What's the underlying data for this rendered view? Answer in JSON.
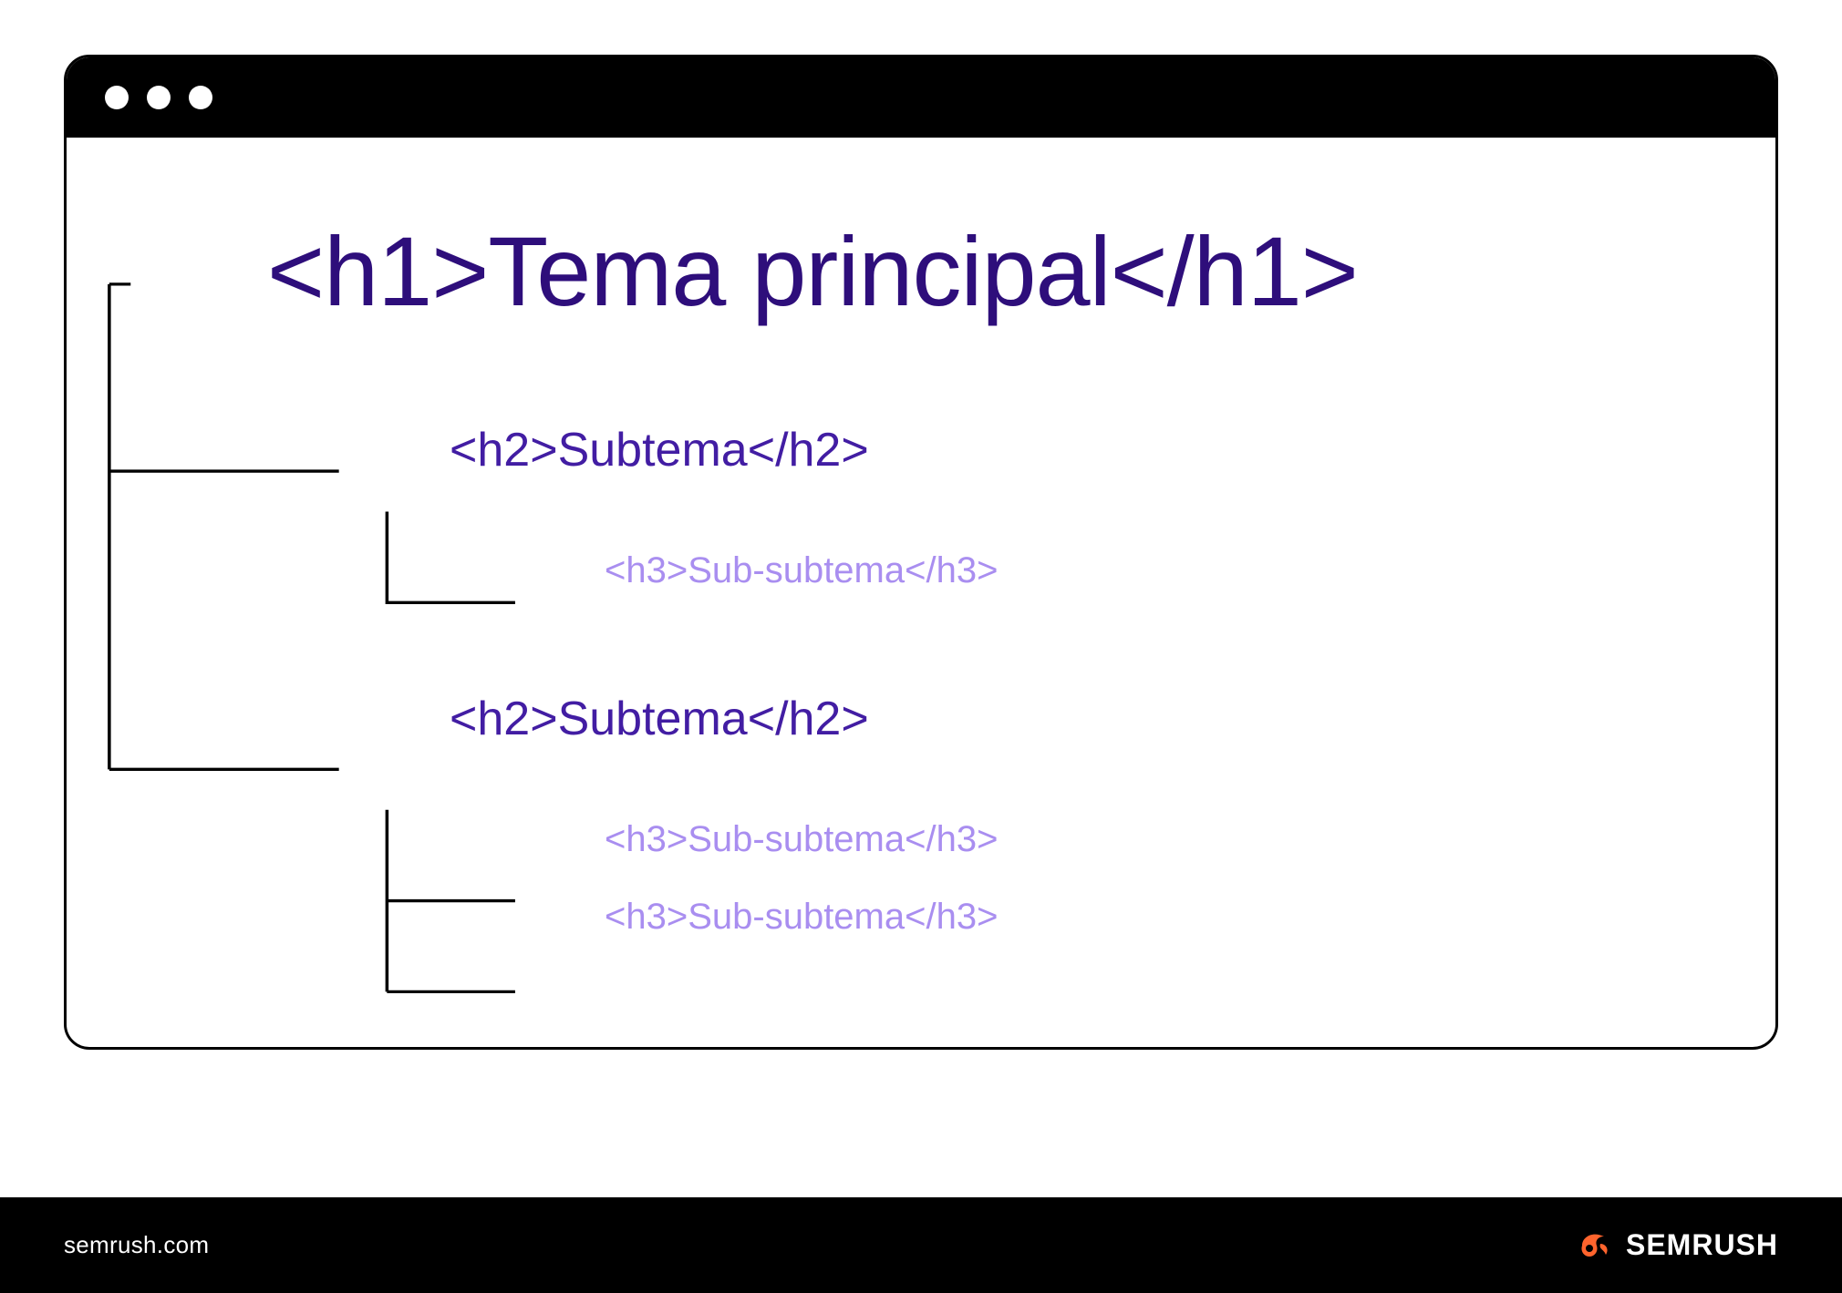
{
  "diagram": {
    "h1": "<h1>Tema principal</h1>",
    "groups": [
      {
        "h2": "<h2>Subtema</h2>",
        "h3": [
          "<h3>Sub-subtema</h3>"
        ]
      },
      {
        "h2": "<h2>Subtema</h2>",
        "h3": [
          "<h3>Sub-subtema</h3>",
          "<h3>Sub-subtema</h3>"
        ]
      }
    ]
  },
  "colors": {
    "h1": "#2E0E7B",
    "h2": "#421DA3",
    "h3": "#A98EF0",
    "brand_accent": "#FF642D"
  },
  "footer": {
    "url": "semrush.com",
    "brand": "SEMRUSH"
  }
}
